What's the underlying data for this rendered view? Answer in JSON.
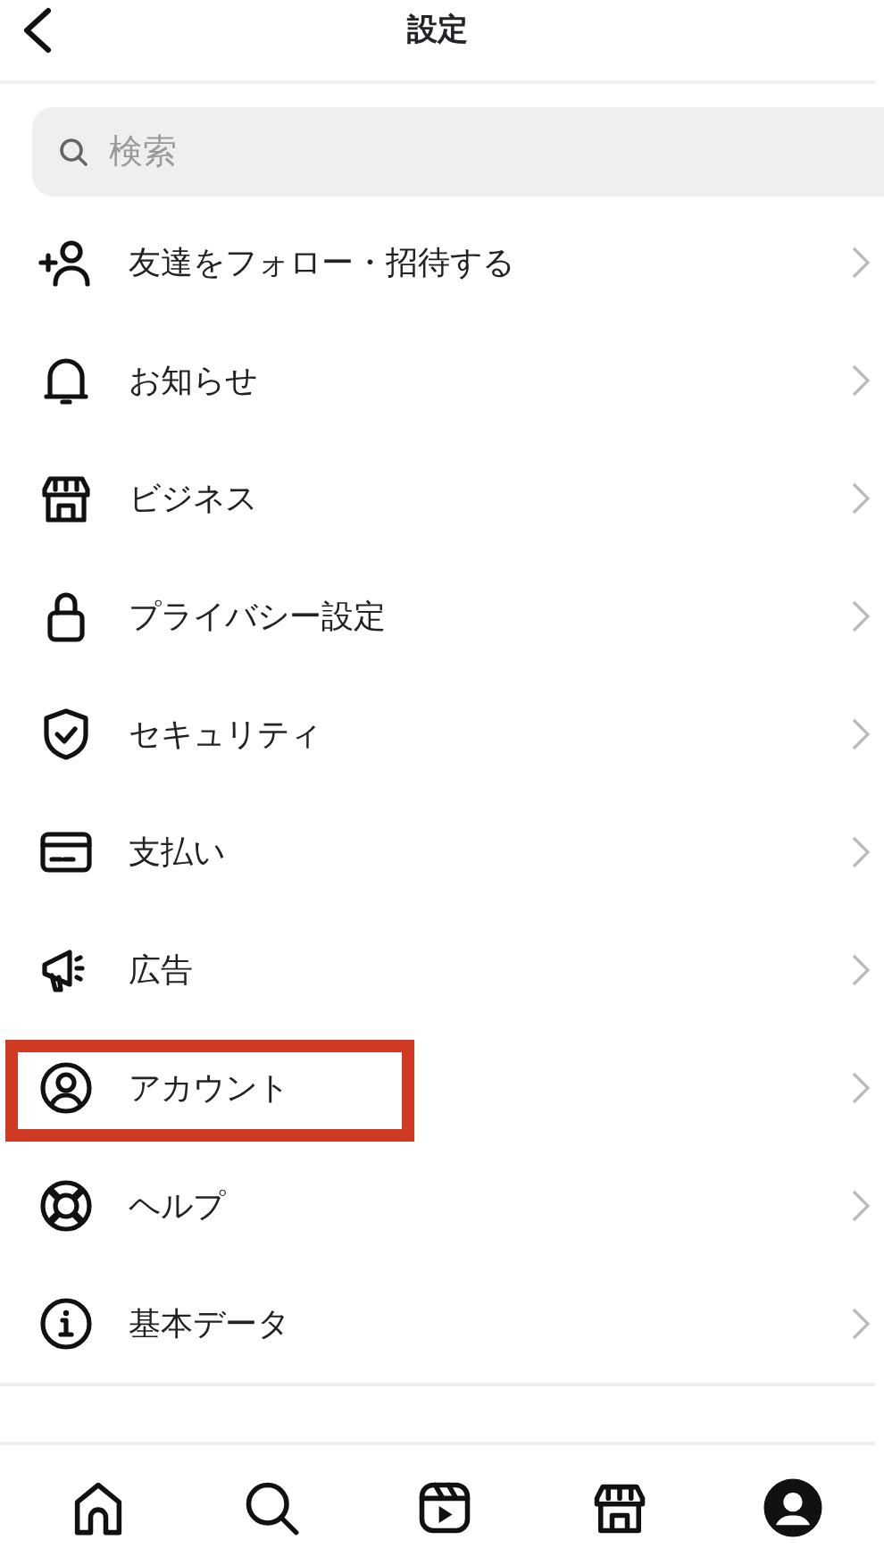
{
  "header": {
    "title": "設定"
  },
  "search": {
    "placeholder": "検索"
  },
  "items": [
    {
      "kind": "add-person",
      "label": "友達をフォロー・招待する",
      "highlighted": false
    },
    {
      "kind": "bell",
      "label": "お知らせ",
      "highlighted": false
    },
    {
      "kind": "shop",
      "label": "ビジネス",
      "highlighted": false
    },
    {
      "kind": "lock",
      "label": "プライバシー設定",
      "highlighted": false
    },
    {
      "kind": "shield",
      "label": "セキュリティ",
      "highlighted": false
    },
    {
      "kind": "card",
      "label": "支払い",
      "highlighted": false
    },
    {
      "kind": "megaphone",
      "label": "広告",
      "highlighted": false
    },
    {
      "kind": "account",
      "label": "アカウント",
      "highlighted": true
    },
    {
      "kind": "lifebuoy",
      "label": "ヘルプ",
      "highlighted": false
    },
    {
      "kind": "info",
      "label": "基本データ",
      "highlighted": false
    }
  ],
  "bottom_nav": [
    {
      "kind": "home",
      "selected": false
    },
    {
      "kind": "search",
      "selected": false
    },
    {
      "kind": "reels",
      "selected": false
    },
    {
      "kind": "shop",
      "selected": false
    },
    {
      "kind": "profile",
      "selected": true
    }
  ]
}
